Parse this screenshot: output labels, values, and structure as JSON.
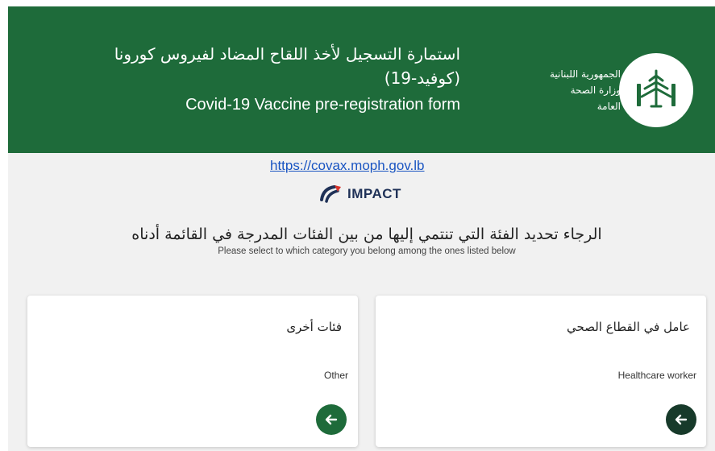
{
  "header": {
    "ministry_lines": [
      "الجمهورية اللبنانية",
      "وزارة الصحة",
      "العامة"
    ],
    "title_ar_line1": "استمارة التسجيل لأخذ اللقاح المضاد لفيروس كورونا",
    "title_ar_line2": "(كوفيد-19)",
    "title_en": "Covid-19 Vaccine pre-registration form",
    "emblem_icon": "cedar-emblem-icon"
  },
  "link": {
    "url_text": "https://covax.moph.gov.lb"
  },
  "impact": {
    "label": "IMPACT",
    "icon": "impact-logo-icon"
  },
  "prompt": {
    "ar": "الرجاء تحديد الفئة التي تنتمي إليها من بين الفئات المدرجة في القائمة أدناه",
    "en": "Please select to which category you belong among the ones listed below"
  },
  "cards": {
    "healthcare": {
      "title_ar": "عامل في القطاع الصحي",
      "title_en": "Healthcare worker",
      "button_icon": "arrow-left-icon"
    },
    "other": {
      "title_ar": "فئات أخرى",
      "title_en": "Other",
      "button_icon": "arrow-left-icon"
    }
  },
  "colors": {
    "header_bg": "#1e6b3a",
    "page_bg": "#f1f1f1",
    "link": "#1a55c2",
    "btn_other": "#1e6b3a",
    "btn_healthcare": "#173a2a"
  }
}
